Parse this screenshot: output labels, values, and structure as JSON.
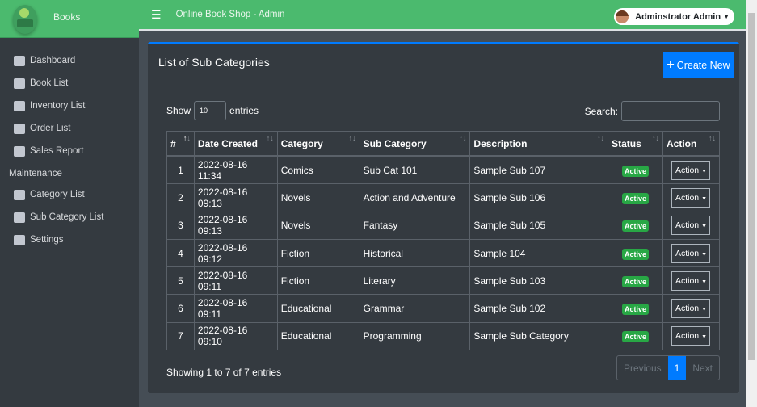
{
  "brand": "Books",
  "app_title": "Online Book Shop - Admin",
  "user": "Adminstrator Admin",
  "sidebar": {
    "items": [
      {
        "label": "Dashboard",
        "icon": "dashboard-icon"
      },
      {
        "label": "Book List",
        "icon": "book-icon"
      },
      {
        "label": "Inventory List",
        "icon": "clipboard-icon"
      },
      {
        "label": "Order List",
        "icon": "list-icon"
      },
      {
        "label": "Sales Report",
        "icon": "file-icon"
      }
    ],
    "section": "Maintenance",
    "maintenance": [
      {
        "label": "Category List",
        "icon": "table-icon"
      },
      {
        "label": "Sub Category List",
        "icon": "table-icon"
      },
      {
        "label": "Settings",
        "icon": "cogs-icon"
      }
    ]
  },
  "card": {
    "title": "List of Sub Categories",
    "create": "Create New"
  },
  "length": {
    "show": "Show",
    "value": "10",
    "entries": "entries"
  },
  "search_label": "Search:",
  "columns": [
    "#",
    "Date Created",
    "Category",
    "Sub Category",
    "Description",
    "Status",
    "Action"
  ],
  "rows": [
    [
      "1",
      "2022-08-16 11:34",
      "Comics",
      "Sub Cat 101",
      "Sample Sub 107",
      "Active",
      "Action"
    ],
    [
      "2",
      "2022-08-16 09:13",
      "Novels",
      "Action and Adventure",
      "Sample Sub 106",
      "Active",
      "Action"
    ],
    [
      "3",
      "2022-08-16 09:13",
      "Novels",
      "Fantasy",
      "Sample Sub 105",
      "Active",
      "Action"
    ],
    [
      "4",
      "2022-08-16 09:12",
      "Fiction",
      "Historical",
      "Sample 104",
      "Active",
      "Action"
    ],
    [
      "5",
      "2022-08-16 09:11",
      "Fiction",
      "Literary",
      "Sample Sub 103",
      "Active",
      "Action"
    ],
    [
      "6",
      "2022-08-16 09:11",
      "Educational",
      "Grammar",
      "Sample Sub 102",
      "Active",
      "Action"
    ],
    [
      "7",
      "2022-08-16 09:10",
      "Educational",
      "Programming",
      "Sample Sub Category",
      "Active",
      "Action"
    ]
  ],
  "info": "Showing 1 to 7 of 7 entries",
  "pager": {
    "prev": "Previous",
    "page": "1",
    "next": "Next"
  },
  "colors": {
    "header": "#4bba6e",
    "accent": "#007bff",
    "active": "#28a745"
  }
}
